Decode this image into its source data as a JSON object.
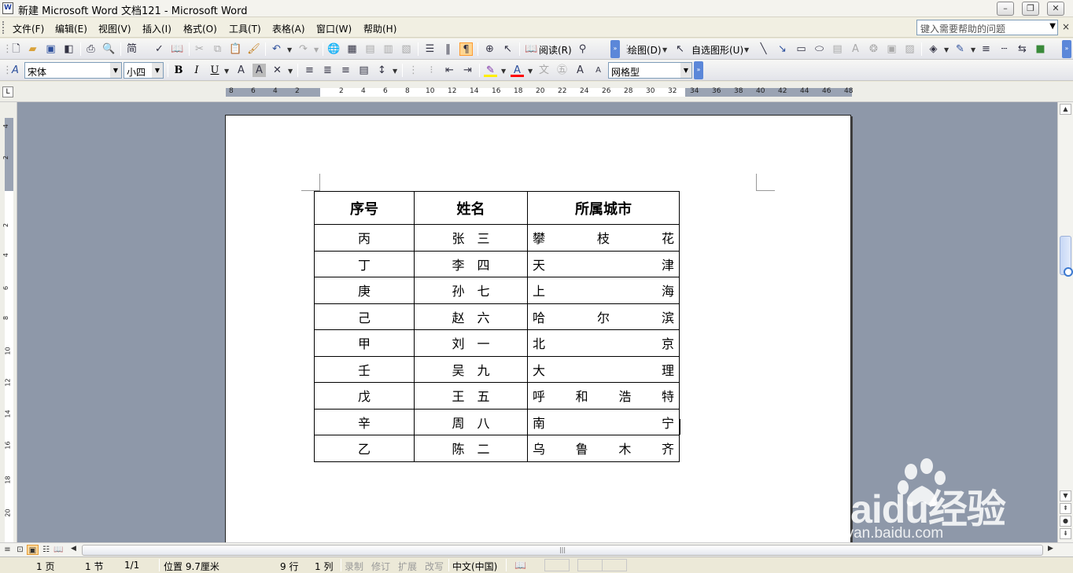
{
  "window": {
    "title": "新建 Microsoft Word 文档121 - Microsoft Word",
    "minimize_glyph": "–",
    "restore_glyph": "❐",
    "close_glyph": "✕"
  },
  "menubar": {
    "items": [
      "文件(F)",
      "编辑(E)",
      "视图(V)",
      "插入(I)",
      "格式(O)",
      "工具(T)",
      "表格(A)",
      "窗口(W)",
      "帮助(H)"
    ],
    "help_placeholder": "键入需要帮助的问题",
    "close_glyph": "×"
  },
  "toolbar1": {
    "read_label": "阅读(R)",
    "draw_label": "绘图(D)",
    "autoshape_label": "自选图形(U)"
  },
  "toolbar2": {
    "style_value": "宋体",
    "font_size_value": "小四",
    "border_style_value": "网格型",
    "bold": "B",
    "italic": "I",
    "underline": "U"
  },
  "ruler": {
    "h_numbers": [
      "8",
      "6",
      "4",
      "2",
      "2",
      "4",
      "6",
      "8",
      "10",
      "12",
      "14",
      "16",
      "18",
      "20",
      "22",
      "24",
      "26",
      "28",
      "30",
      "32",
      "34",
      "36",
      "38",
      "40",
      "42",
      "44",
      "46",
      "48"
    ],
    "v_numbers": [
      "4",
      "2",
      "2",
      "4",
      "6",
      "8",
      "10",
      "12",
      "14",
      "16",
      "18",
      "20"
    ],
    "corner_glyph": "L"
  },
  "document": {
    "table": {
      "headers": [
        "序号",
        "姓名",
        "所属城市"
      ],
      "rows": [
        {
          "index": "丙",
          "name": "张　三",
          "city": [
            "攀",
            "枝",
            "花"
          ]
        },
        {
          "index": "丁",
          "name": "李　四",
          "city": [
            "天",
            "津"
          ]
        },
        {
          "index": "庚",
          "name": "孙　七",
          "city": [
            "上",
            "海"
          ]
        },
        {
          "index": "己",
          "name": "赵　六",
          "city": [
            "哈",
            "尔",
            "滨"
          ]
        },
        {
          "index": "甲",
          "name": "刘　一",
          "city": [
            "北",
            "京"
          ]
        },
        {
          "index": "壬",
          "name": "吴　九",
          "city": [
            "大",
            "理"
          ]
        },
        {
          "index": "戊",
          "name": "王　五",
          "city": [
            "呼",
            "和",
            "浩",
            "特"
          ]
        },
        {
          "index": "辛",
          "name": "周　八",
          "city": [
            "南",
            "宁"
          ]
        },
        {
          "index": "乙",
          "name": "陈　二",
          "city": [
            "乌",
            "鲁",
            "木",
            "齐"
          ]
        }
      ]
    }
  },
  "watermark": {
    "logo_text": "Baidu经验",
    "url_text": "jingyan.baidu.com"
  },
  "statusbar": {
    "page": "1 页",
    "section": "1 节",
    "page_of": "1/1",
    "position": "位置 9.7厘米",
    "line": "9 行",
    "column": "1 列",
    "rec": "录制",
    "trk": "修订",
    "ext": "扩展",
    "ovr": "改写",
    "language": "中文(中国)"
  }
}
